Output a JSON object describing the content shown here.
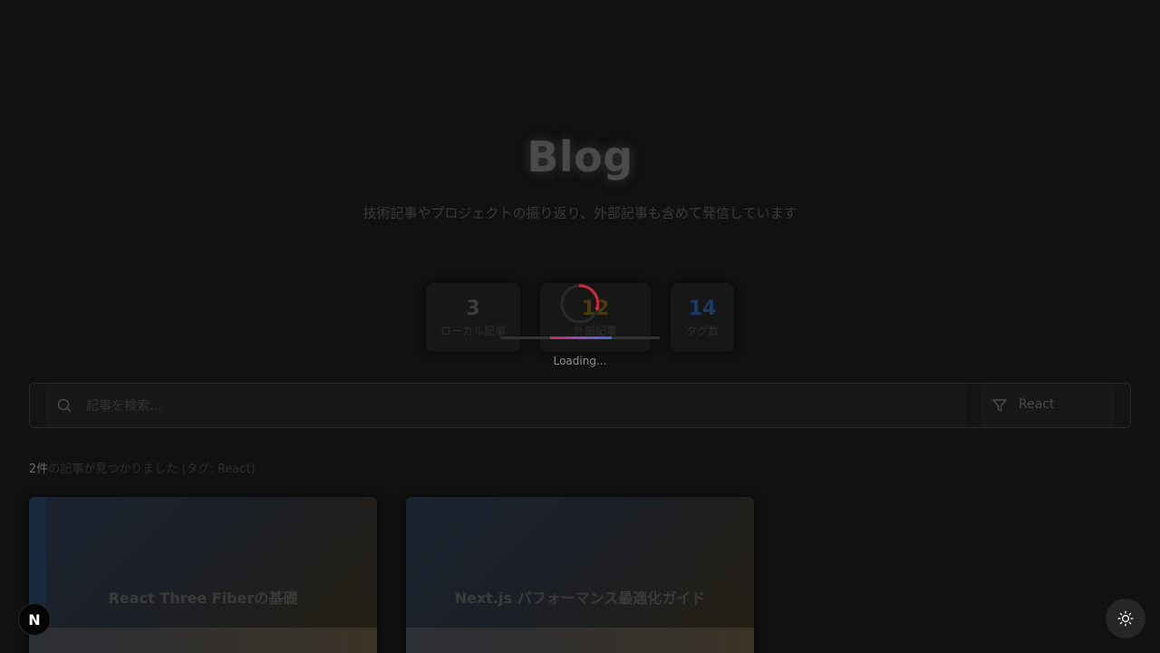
{
  "header": {
    "title": "Blog",
    "subtitle": "技術記事やプロジェクトの振り返り、外部記事も含めて発信しています"
  },
  "stats": [
    {
      "value": "3",
      "label": "ローカル記事",
      "color": "#3d3d3d"
    },
    {
      "value": "12",
      "label": "外部記事",
      "color": "#4a3a10"
    },
    {
      "value": "14",
      "label": "タグ数",
      "color": "#1c3a66"
    }
  ],
  "loading": {
    "text": "Loading...",
    "progress_start": 0.31,
    "progress_fraction": 0.39,
    "gradient": [
      "#c8284a",
      "#9050c0",
      "#3c6ee0"
    ]
  },
  "search": {
    "placeholder": "記事を検索...",
    "value": ""
  },
  "filter": {
    "selected": "React",
    "icon": "filter-icon"
  },
  "results": {
    "count": "2件",
    "text": "の記事が見つかりました (タグ: React)"
  },
  "articles": [
    {
      "title": "React Three Fiberの基礎"
    },
    {
      "title": "Next.js パフォーマンス最適化ガイド"
    }
  ],
  "floating": {
    "next_badge": "N",
    "theme_icon": "sun-icon"
  }
}
